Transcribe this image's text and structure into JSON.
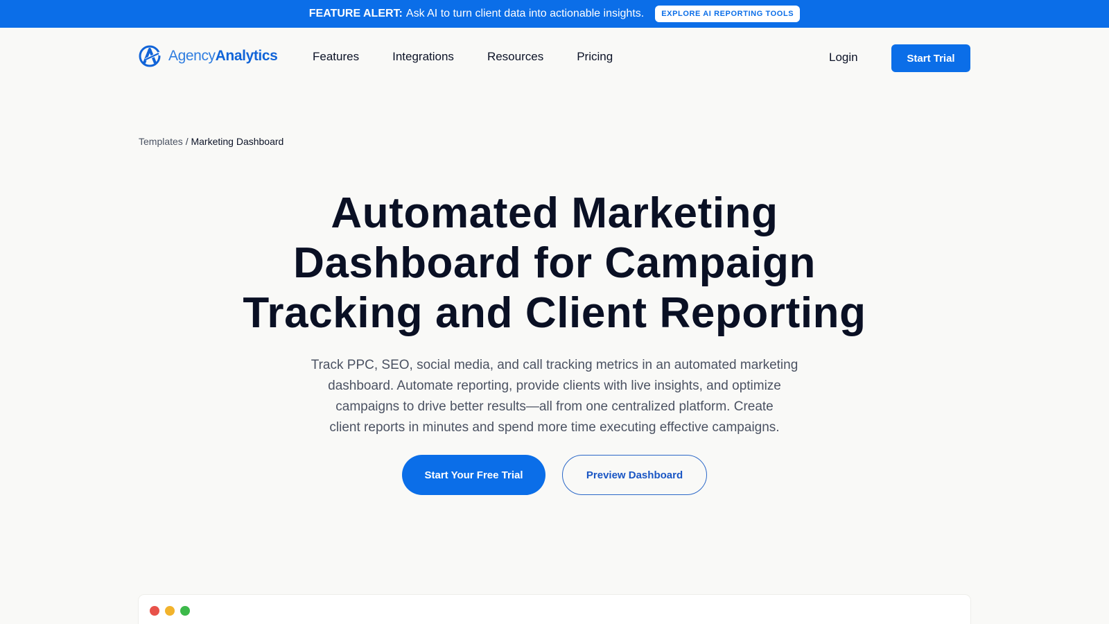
{
  "alert": {
    "label": "FEATURE ALERT:",
    "text": "Ask AI to turn client data into actionable insights.",
    "cta": "EXPLORE AI REPORTING TOOLS"
  },
  "brand": {
    "name_part1": "Agency",
    "name_part2": "Analytics",
    "color_primary": "#0b6ee8",
    "logo_icon": "agencyanalytics-logo-icon"
  },
  "nav": {
    "links": [
      "Features",
      "Integrations",
      "Resources",
      "Pricing"
    ],
    "login": "Login",
    "start_trial": "Start Trial"
  },
  "breadcrumb": {
    "parent": "Templates",
    "separator": "/",
    "current": "Marketing Dashboard"
  },
  "hero": {
    "title_lines": [
      "Automated Marketing",
      "Dashboard for Campaign",
      "Tracking and Client Reporting"
    ],
    "subtitle_lines": [
      "Track PPC, SEO, social media, and call tracking metrics in an automated marketing",
      "dashboard. Automate reporting, provide clients with live insights, and optimize",
      "campaigns to drive better results—all from one centralized platform. Create",
      "client reports in minutes and spend more time executing effective campaigns."
    ],
    "primary_cta": "Start Your Free Trial",
    "secondary_cta": "Preview Dashboard"
  },
  "preview": {
    "window_dot_colors": [
      "#e8524a",
      "#f2b32c",
      "#3cb94a"
    ]
  }
}
